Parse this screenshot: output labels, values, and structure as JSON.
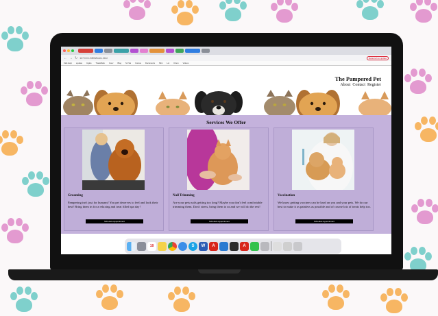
{
  "browser": {
    "tabs": [
      {
        "label": "",
        "color": "#d6403a"
      },
      {
        "label": "",
        "color": "#2f7de1"
      },
      {
        "label": "",
        "color": "#8a8f98"
      },
      {
        "label": "",
        "color": "#3aa1a8"
      },
      {
        "label": "",
        "color": "#b24fd1"
      },
      {
        "label": "",
        "color": "#e37fd0"
      },
      {
        "label": "",
        "color": "#e3913a"
      },
      {
        "label": "",
        "color": "#b24fd1"
      },
      {
        "label": "",
        "color": "#3fa55a"
      },
      {
        "label": "",
        "color": "#2f7de1"
      },
      {
        "label": "",
        "color": "#8a8f98"
      }
    ],
    "url": "127.0.0.1:5500/index.html",
    "relaunch_label": "Relaunch to update",
    "bookmarks": [
      "Kids Help",
      "ayudas",
      "Inglés",
      "TradeMark",
      "Conv",
      "Blog",
      "Sri Vai",
      "Cursos",
      "Documents",
      "Mini",
      "Lot",
      "Chem",
      "Videos"
    ]
  },
  "site": {
    "brand": "The Pampered Pet",
    "nav": [
      "About",
      "Contact",
      "Register"
    ],
    "services_title": "Services We Offer",
    "services": [
      {
        "name": "Grooming",
        "description": "Pampering isn't just for humans! You pet deserves to feel and look their best! Bring them in for a relaxing and treat filled spa day!",
        "button": "Schedule Appointment"
      },
      {
        "name": "Nail Trimming",
        "description": "Are your pets nails getting too long? Maybe you don't feel comfortable trimming them. Don't stress, bring them to us and we will do the rest!",
        "button": "Schedule Appointment"
      },
      {
        "name": "Vaccination",
        "description": "We know getting vaccines can be hard on you and your pets. We do our best to make it as painless as possible and of course lots of treats help too.",
        "button": "Schedule Appointment"
      }
    ]
  },
  "dock": [
    "finder",
    "launchpad",
    "calendar",
    "notes",
    "chrome",
    "safari",
    "skype",
    "word",
    "pdf",
    "vscode",
    "terminal",
    "acrobat",
    "facetime",
    "preview",
    "files",
    "trash"
  ],
  "colors": {
    "lavender": "#c4b2dc",
    "paw_teal": "#7fd0cc",
    "paw_pink": "#e39ad0",
    "paw_orange": "#f7b663"
  }
}
